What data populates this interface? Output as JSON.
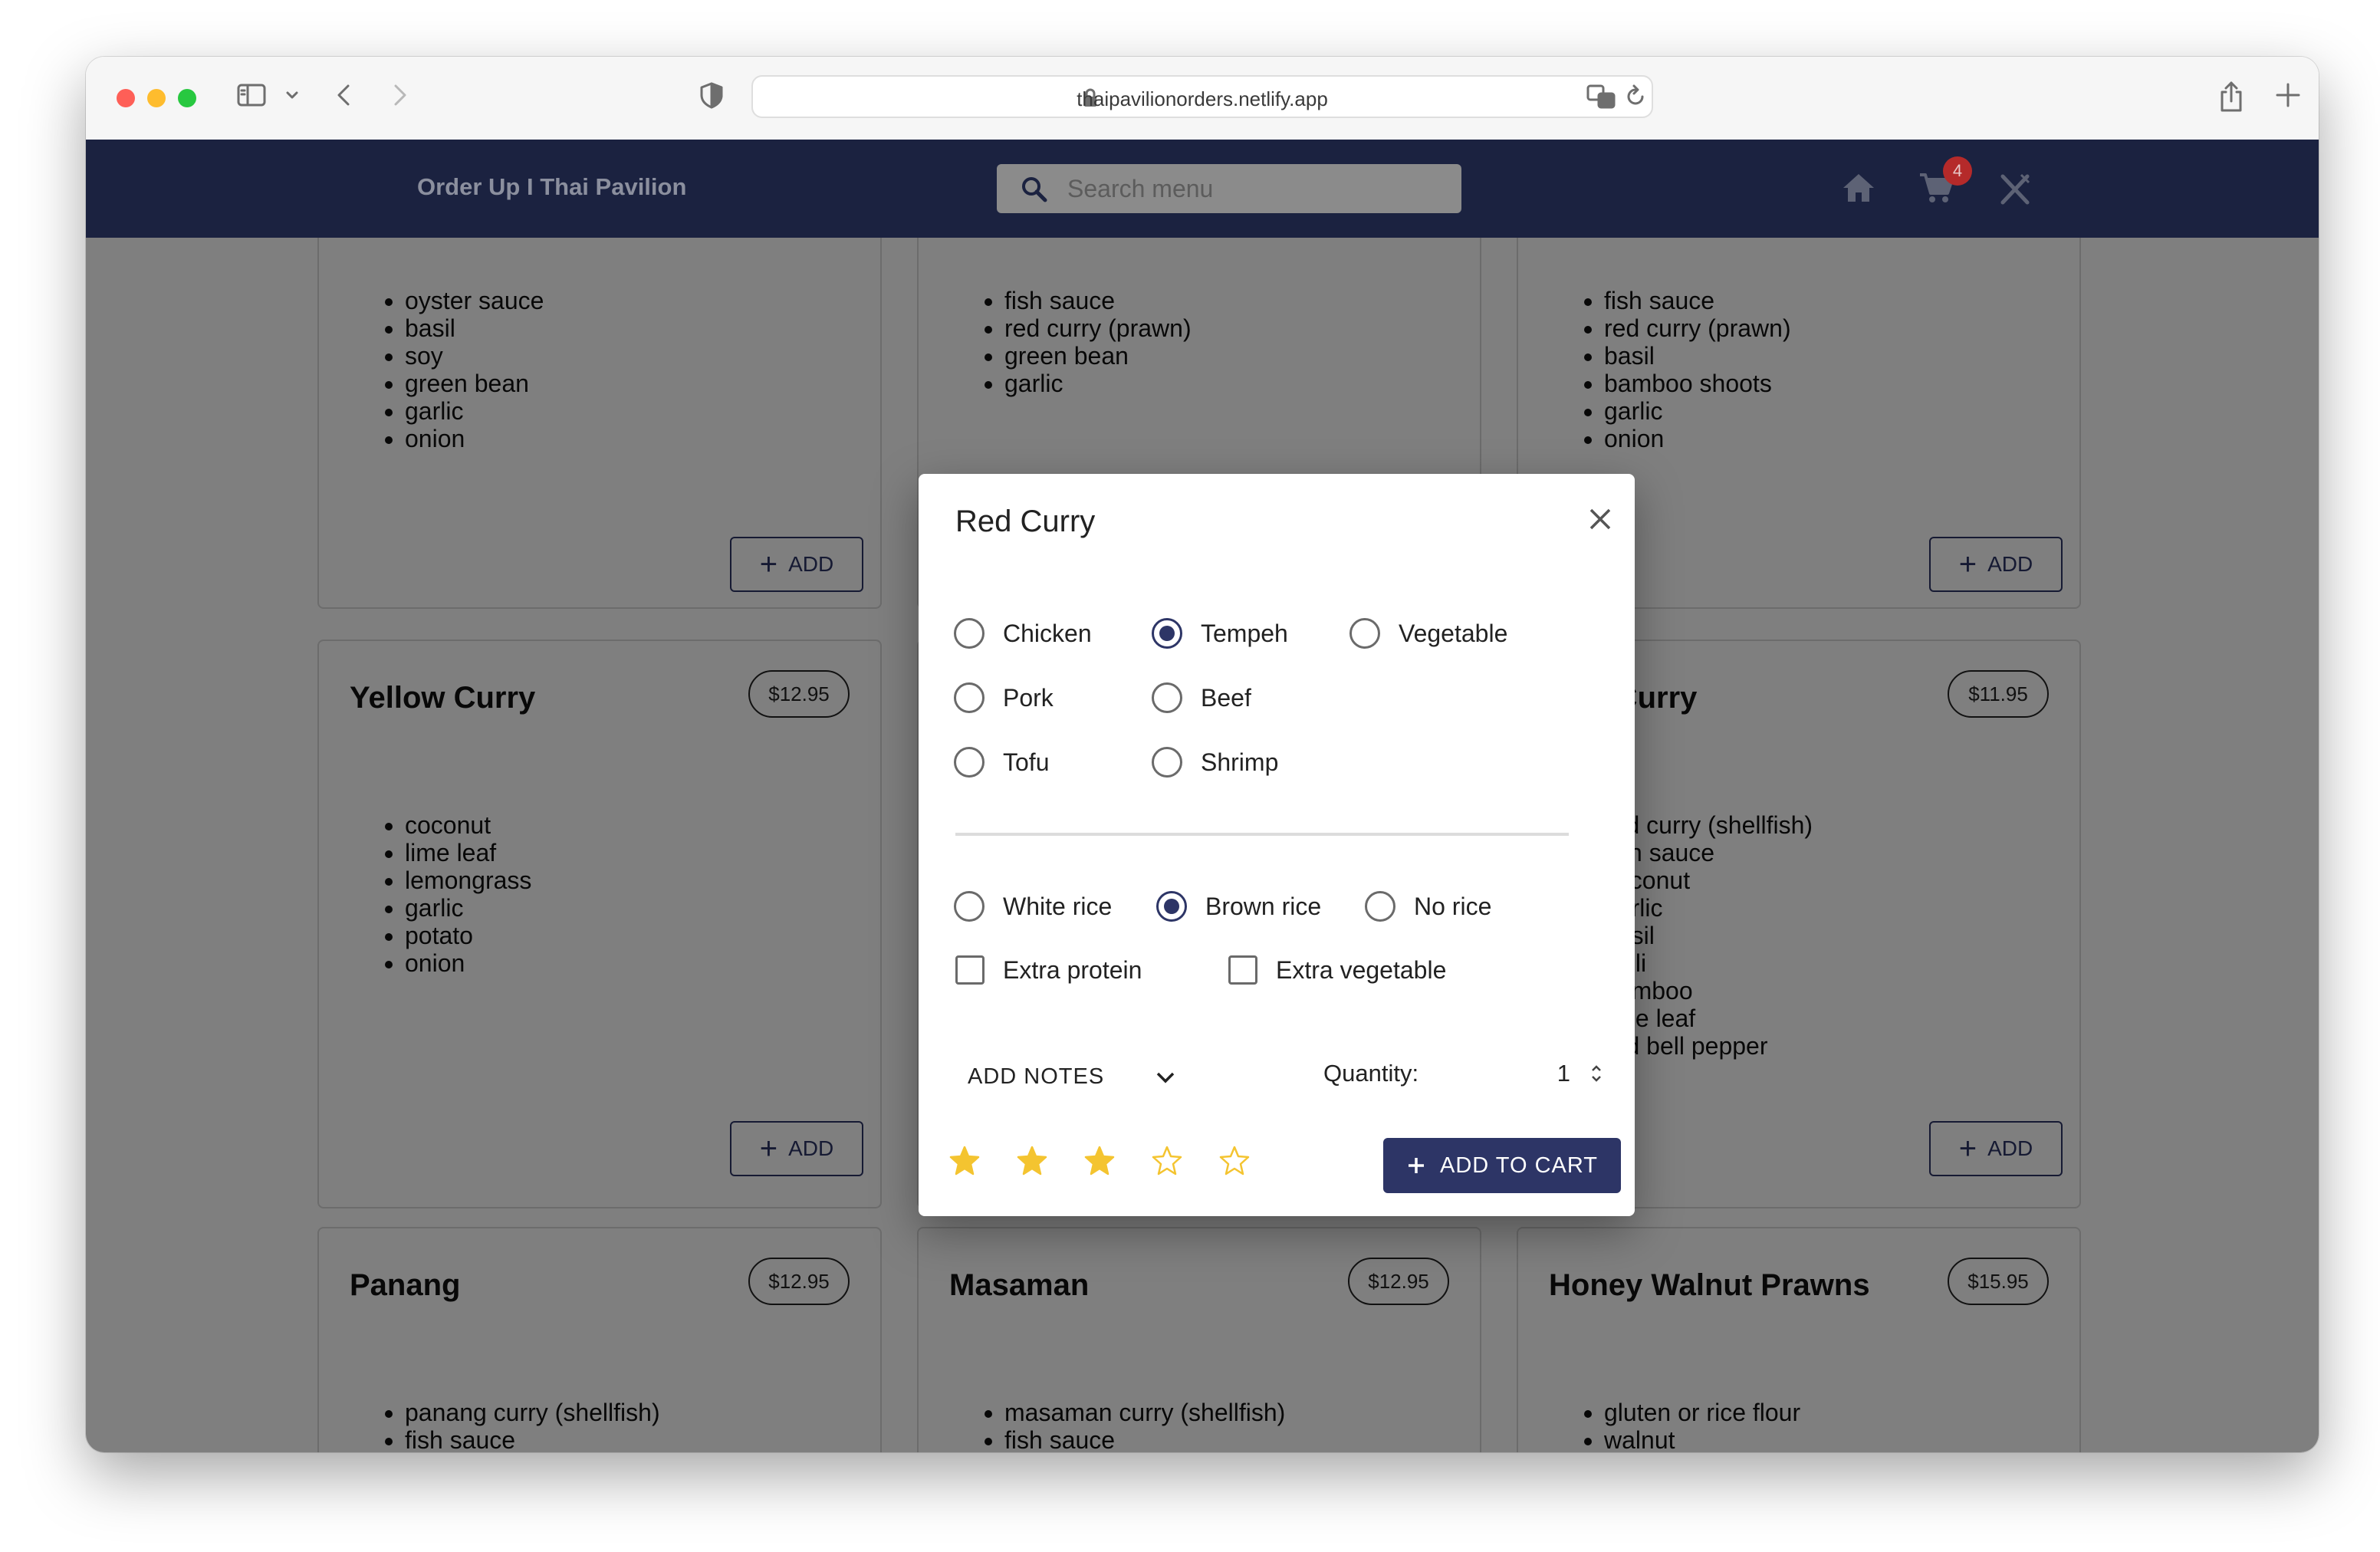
{
  "browser": {
    "url": "thaipavilionorders.netlify.app"
  },
  "app": {
    "title": "Order Up I Thai Pavilion",
    "search_placeholder": "Search menu",
    "cart_badge": "4"
  },
  "menu": {
    "cards": [
      {
        "name": "",
        "price": "",
        "ingredients": [
          "oyster sauce",
          "basil",
          "soy",
          "green bean",
          "garlic",
          "onion"
        ],
        "add_label": "ADD"
      },
      {
        "name": "",
        "price": "",
        "ingredients": [
          "fish sauce",
          "red curry (prawn)",
          "green bean",
          "garlic"
        ],
        "add_label": ""
      },
      {
        "name": "",
        "price": "",
        "ingredients": [
          "fish sauce",
          "red curry (prawn)",
          "basil",
          "bamboo shoots",
          "garlic",
          "onion"
        ],
        "add_label": "ADD"
      },
      {
        "name": "Yellow Curry",
        "price": "$12.95",
        "ingredients": [
          "coconut",
          "lime leaf",
          "lemongrass",
          "garlic",
          "potato",
          "onion"
        ],
        "add_label": "ADD"
      },
      {
        "name": "",
        "price": "",
        "ingredients": [],
        "add_label": ""
      },
      {
        "name": "Red Curry",
        "price": "$11.95",
        "ingredients": [
          "red curry (shellfish)",
          "fish sauce",
          "coconut",
          "garlic",
          "basil",
          "chili",
          "bamboo",
          "lime leaf",
          "red bell pepper"
        ],
        "add_label": "ADD"
      },
      {
        "name": "Panang",
        "price": "$12.95",
        "ingredients": [
          "panang curry (shellfish)",
          "fish sauce"
        ],
        "add_label": ""
      },
      {
        "name": "Masaman",
        "price": "$12.95",
        "ingredients": [
          "masaman curry (shellfish)",
          "fish sauce"
        ],
        "add_label": ""
      },
      {
        "name": "Honey Walnut Prawns",
        "price": "$15.95",
        "ingredients": [
          "gluten or rice flour",
          "walnut"
        ],
        "add_label": ""
      }
    ]
  },
  "modal": {
    "title": "Red Curry",
    "proteins": [
      {
        "label": "Chicken",
        "selected": false
      },
      {
        "label": "Tempeh",
        "selected": true
      },
      {
        "label": "Vegetable",
        "selected": false
      },
      {
        "label": "Pork",
        "selected": false
      },
      {
        "label": "Beef",
        "selected": false
      },
      {
        "label": "Tofu",
        "selected": false
      },
      {
        "label": "Shrimp",
        "selected": false
      }
    ],
    "rice": [
      {
        "label": "White rice",
        "selected": false
      },
      {
        "label": "Brown rice",
        "selected": true
      },
      {
        "label": "No rice",
        "selected": false
      }
    ],
    "extras": [
      {
        "label": "Extra protein",
        "checked": false
      },
      {
        "label": "Extra vegetable",
        "checked": false
      }
    ],
    "notes_label": "ADD NOTES",
    "quantity_label": "Quantity:",
    "quantity_value": "1",
    "rating": 3,
    "rating_max": 5,
    "add_to_cart_label": "ADD TO CART"
  },
  "colors": {
    "header": "#1b2240",
    "primary": "#2d3566",
    "star": "#f4c430",
    "badge": "#b52a2a"
  }
}
